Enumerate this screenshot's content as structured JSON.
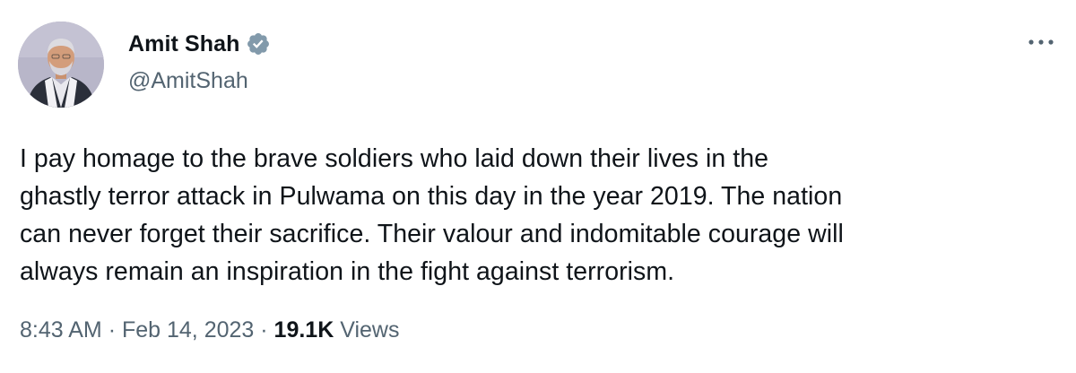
{
  "author": {
    "display_name": "Amit Shah",
    "handle": "@AmitShah",
    "verified_icon": "verified-badge-icon",
    "verified_color": "#829aab"
  },
  "tweet": {
    "text_lines": [
      "I pay homage to the brave soldiers who laid down their lives in the",
      "ghastly terror attack in Pulwama on this day in the year 2019. The nation",
      "can never forget their sacrifice. Their valour and indomitable courage will",
      "always remain an inspiration in the fight against terrorism."
    ]
  },
  "meta": {
    "time": "8:43 AM",
    "separator": "·",
    "date": "Feb 14, 2023",
    "views_count": "19.1K",
    "views_label": "Views"
  },
  "menu": {
    "icon": "more-options-icon"
  },
  "colors": {
    "text_primary": "#0f1419",
    "text_secondary": "#536471"
  }
}
